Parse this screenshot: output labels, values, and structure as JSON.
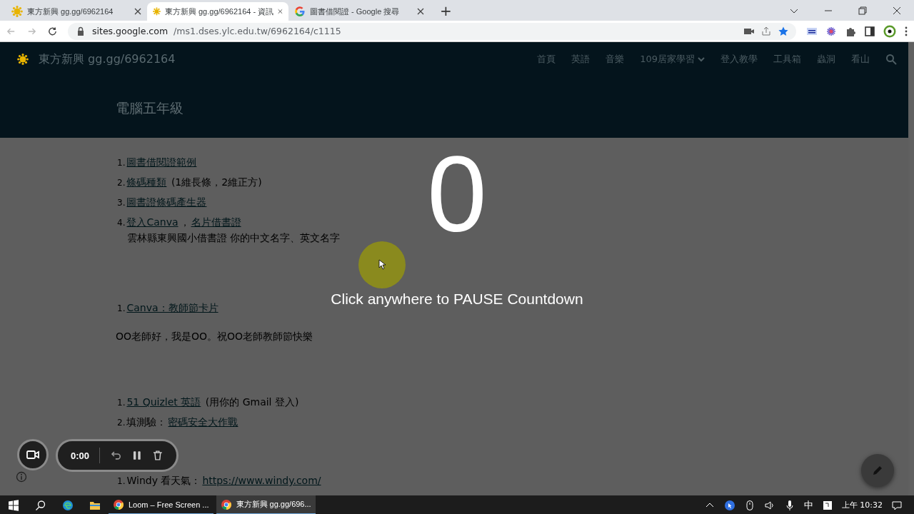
{
  "browser": {
    "tabs": [
      {
        "title": "東方新興 gg.gg/6962164",
        "selected": false
      },
      {
        "title": "東方新興 gg.gg/6962164 - 資訊",
        "selected": true
      },
      {
        "title": "圖書借閱證 - Google 搜尋",
        "selected": false
      }
    ],
    "new_tab": "+",
    "url_host": "sites.google.com",
    "url_path": "/ms1.dses.ylc.edu.tw/6962164/c1115"
  },
  "site": {
    "title": "東方新興 gg.gg/6962164",
    "nav": [
      {
        "label": "首頁",
        "dropdown": false
      },
      {
        "label": "英語",
        "dropdown": false
      },
      {
        "label": "音樂",
        "dropdown": false
      },
      {
        "label": "109居家學習",
        "dropdown": true
      },
      {
        "label": "登入教學",
        "dropdown": false
      },
      {
        "label": "工具箱",
        "dropdown": false
      },
      {
        "label": "蟲洞",
        "dropdown": false
      },
      {
        "label": "看山",
        "dropdown": false
      }
    ],
    "page_title": "電腦五年級"
  },
  "content": [
    {
      "kind": "list",
      "items": [
        {
          "number": "1.",
          "parts": [
            {
              "kind": "link",
              "text": "圖書借閱證範例"
            }
          ]
        },
        {
          "number": "2.",
          "parts": [
            {
              "kind": "link",
              "text": "條碼種類"
            },
            {
              "kind": "text",
              "text": " (1維長條，2維正方)"
            }
          ]
        },
        {
          "number": "3.",
          "parts": [
            {
              "kind": "link",
              "text": "圖書證條碼產生器"
            }
          ]
        },
        {
          "number": "4.",
          "parts": [
            {
              "kind": "link",
              "text": "登入Canva"
            },
            {
              "kind": "text",
              "text": "，"
            },
            {
              "kind": "link",
              "text": "名片借書證"
            }
          ],
          "note": "雲林縣東興國小借書證 你的中文名字、英文名字"
        }
      ]
    },
    {
      "kind": "list",
      "items": [
        {
          "number": "1.",
          "parts": [
            {
              "kind": "link",
              "text": "Canva：教師節卡片"
            }
          ]
        }
      ]
    },
    {
      "kind": "paragraph",
      "text": "OO老師好，我是OO。祝OO老師教師節快樂"
    },
    {
      "kind": "list",
      "items": [
        {
          "number": "1.",
          "parts": [
            {
              "kind": "link",
              "text": "51 Quizlet 英語"
            },
            {
              "kind": "text",
              "text": " (用你的 Gmail 登入)"
            }
          ]
        },
        {
          "number": "2.",
          "parts": [
            {
              "kind": "text",
              "text": "填測驗："
            },
            {
              "kind": "link",
              "text": "密碼安全大作戰"
            }
          ]
        }
      ]
    },
    {
      "kind": "list",
      "items": [
        {
          "number": "1.",
          "parts": [
            {
              "kind": "text",
              "text": "Windy 看天氣："
            },
            {
              "kind": "link",
              "text": "https://www.windy.com/"
            }
          ]
        }
      ]
    }
  ],
  "countdown": {
    "number": "0",
    "hint": "Click anywhere to PAUSE Countdown"
  },
  "recorder": {
    "time": "0:00"
  },
  "taskbar": {
    "apps": [
      {
        "label": "Loom – Free Screen ...",
        "selected": false
      },
      {
        "label": "東方新興 gg.gg/696...",
        "selected": true
      }
    ],
    "ime": "中",
    "clock": "上午 10:32"
  }
}
